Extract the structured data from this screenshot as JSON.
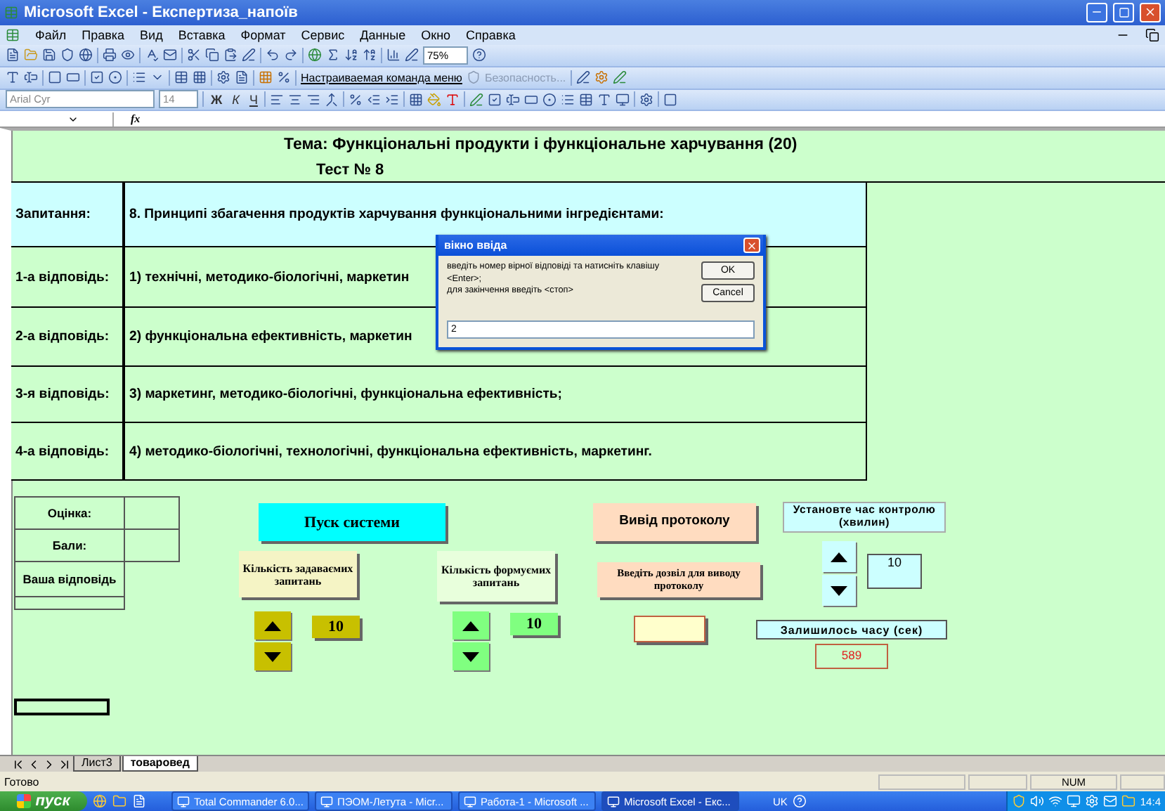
{
  "window": {
    "title": "Microsoft Excel - Експертиза_напоїв"
  },
  "menu": [
    "Файл",
    "Правка",
    "Вид",
    "Вставка",
    "Формат",
    "Сервис",
    "Данные",
    "Окно",
    "Справка"
  ],
  "toolbar": {
    "zoom": "75%",
    "custom_command": "Настраиваемая команда меню",
    "security": "Безопасность..."
  },
  "format_bar": {
    "font": "Arial Cyr",
    "size": "14",
    "bold": "Ж",
    "italic": "К",
    "underline": "Ч"
  },
  "formula_bar": {
    "fx": "fx"
  },
  "sheet": {
    "title": "Тема:  Функціональні продукти і функціональне харчування (20)",
    "test": "Тест № 8",
    "rows": [
      {
        "kind": "question",
        "label": "Запитання:",
        "text": "8. Принципі збагачення продуктів харчування функціональними інгредієнтами:"
      },
      {
        "kind": "answer",
        "label": "1-а відповідь:",
        "text": "1) технічні, методико-біологічні, маркетин"
      },
      {
        "kind": "answer",
        "label": "2-а відповідь:",
        "text": "2) функціональна ефективність, маркетин"
      },
      {
        "kind": "answer",
        "label": "3-я відповідь:",
        "text": "3) маркетинг, методико-біологічні, функціональна ефективність;"
      },
      {
        "kind": "answer",
        "label": "4-а відповідь:",
        "text": "4) методико-біологічні, технологічні, функціональна ефективність, маркетинг."
      }
    ],
    "score_labels": [
      "Оцінка:",
      "Бали:",
      "Ваша відповідь"
    ],
    "start_button": "Пуск системи",
    "protocol_button": "Вивід протоколу",
    "permit_button": "Введіть дозвіл для виводу протоколу",
    "counters": [
      {
        "label": "Кількість задаваємих запитань",
        "value": "10",
        "color": "#c8c000"
      },
      {
        "label": "Кількість формуємих запитань",
        "value": "10",
        "color": "#80ff80"
      }
    ],
    "timer": {
      "label": "Установте час контролю (хвилин)",
      "value": "10",
      "remaining_label": "Залишилось часу (сек)",
      "remaining": "589"
    }
  },
  "dialog": {
    "title": "вікно ввіда",
    "message": "введіть номер вірної відповіді та натисніть клавішу\n<Enter>;\nдля закінчення введіть <стоп>",
    "ok": "OK",
    "cancel": "Cancel",
    "value": "2"
  },
  "sheet_tabs": [
    {
      "label": "Лист3",
      "selected": false
    },
    {
      "label": "товаровед",
      "selected": true
    }
  ],
  "status": {
    "text": "Готово",
    "num": "NUM"
  },
  "taskbar": {
    "start": "пуск",
    "tasks": [
      {
        "label": "Total Commander 6.0...",
        "selected": false
      },
      {
        "label": "ПЭОМ-Летута - Micr...",
        "selected": false
      },
      {
        "label": "Работа-1 - Microsoft ...",
        "selected": false
      },
      {
        "label": "Microsoft Excel - Екс...",
        "selected": true
      }
    ],
    "lang": "UK",
    "clock": "14:4"
  }
}
